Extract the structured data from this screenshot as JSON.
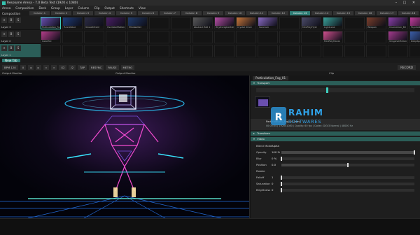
{
  "window": {
    "app_icon": "resolume-icon",
    "title": "Resolume Arena - 7.0 Beta Test (1920 x 1080)",
    "min": "–",
    "max": "□",
    "close": "✕"
  },
  "menu": [
    "Arena",
    "Composition",
    "Deck",
    "Group",
    "Layer",
    "Column",
    "Clip",
    "Output",
    "Shortcuts",
    "View"
  ],
  "deck": {
    "label": "Composition",
    "columns": [
      "Column 1",
      "Column 2",
      "Column 3",
      "Column 4",
      "Column 5",
      "Column 6",
      "Column 7",
      "Column 8",
      "Column 9",
      "Column 10",
      "Column 11",
      "Column 12",
      "Column 13",
      "Column 14",
      "Column 15",
      "Column 16",
      "Column 17",
      "Column 18"
    ],
    "active_column": 12
  },
  "layers": [
    {
      "name": "Layer 3",
      "clips": [
        {
          "name": "Particulation_Fo...",
          "color": "#6a4fb0",
          "selected": true
        },
        {
          "name": "Tunnelblue",
          "color": "#1f3d7a"
        },
        {
          "name": "SmoothSwirl",
          "color": "#2c2c44"
        },
        {
          "name": "OscilatorMotion",
          "color": "#4a1f66"
        },
        {
          "name": "Mindwalker",
          "color": "#203a6b"
        },
        {
          "name": "",
          "color": ""
        },
        {
          "name": "",
          "color": ""
        },
        {
          "name": "Abstract Bell 1",
          "color": "#5b5b5b"
        },
        {
          "name": "Rhythmigliarities",
          "color": "#b64fa6"
        },
        {
          "name": "Crystal Drive",
          "color": "#c7763a"
        },
        {
          "name": "Sanctum",
          "color": "#8a6bc4"
        },
        {
          "name": "",
          "color": ""
        },
        {
          "name": "MiniPolyFlyer",
          "color": "#4c4c6a"
        },
        {
          "name": "Lightcone",
          "color": "#3aa29a"
        },
        {
          "name": "",
          "color": ""
        },
        {
          "name": "Weapon",
          "color": "#7b3f2c"
        },
        {
          "name": "Chameleon_Bll",
          "color": "#8a3fa8"
        },
        {
          "name": "Psychedelic",
          "color": "#c13c9b"
        },
        {
          "name": "Bloodhoundmath",
          "color": "#e07aa8"
        }
      ]
    },
    {
      "name": "Layer 2",
      "clips": [
        {
          "name": "Colorfire",
          "color": "#b43d8a"
        },
        {
          "name": "",
          "color": ""
        },
        {
          "name": "",
          "color": ""
        },
        {
          "name": "",
          "color": ""
        },
        {
          "name": "",
          "color": ""
        },
        {
          "name": "",
          "color": ""
        },
        {
          "name": "",
          "color": ""
        },
        {
          "name": "",
          "color": ""
        },
        {
          "name": "",
          "color": ""
        },
        {
          "name": "",
          "color": ""
        },
        {
          "name": "",
          "color": ""
        },
        {
          "name": "",
          "color": ""
        },
        {
          "name": "",
          "color": ""
        },
        {
          "name": "MiniPolyMania",
          "color": "#d0508e"
        },
        {
          "name": "",
          "color": ""
        },
        {
          "name": "",
          "color": ""
        },
        {
          "name": "SlingshotFiction",
          "color": "#a43b8e"
        },
        {
          "name": "DeepSpaceTeleport",
          "color": "#3b5ea8"
        },
        {
          "name": "Blackmaths",
          "color": "#7e4aa0"
        }
      ]
    },
    {
      "name": "Layer 1",
      "active": true,
      "clips": []
    }
  ],
  "transport": {
    "tab": "New Tab"
  },
  "controls": [
    "BPM 120",
    "II",
    "◂",
    "▸",
    "«",
    "»",
    "X2",
    "/2",
    "TAP",
    "RESYNC",
    "PAUSE",
    "METRO"
  ],
  "controls_right": "RECORD",
  "panels": {
    "output": "Output Monitor",
    "clip": "Clip"
  },
  "output_monitor_label": "Output Monitor",
  "clip_panel": {
    "tab": "Particulation_Fog_01",
    "sections": {
      "transport": "Transport",
      "composition": "Transform",
      "video": "Video"
    },
    "params": [
      {
        "label": "Blend Mode",
        "value": "Alpha",
        "level": null
      },
      {
        "label": "Opacity",
        "value": "100 %",
        "level": 1.0
      },
      {
        "label": "Blur",
        "value": "0 %",
        "level": 0.0
      },
      {
        "label": "Position",
        "value": "0.0",
        "level": 0.5
      },
      {
        "label": "Rotate",
        "value": "",
        "level": null
      },
      {
        "label": "Falloff",
        "value": "1",
        "level": 0.0
      },
      {
        "label": "Saturation",
        "value": "0",
        "level": 0.0
      },
      {
        "label": "Brightness",
        "value": "0",
        "level": 0.0
      }
    ],
    "source": "Particulation_Fog_01.mov",
    "info": "00:05:04 | 1920x1080 | Quality: 60 fps | Codec: DXV3 Normal | 48000 Hz"
  },
  "watermark": {
    "line1": "RAHIM",
    "line2": "SOFTWARES"
  }
}
